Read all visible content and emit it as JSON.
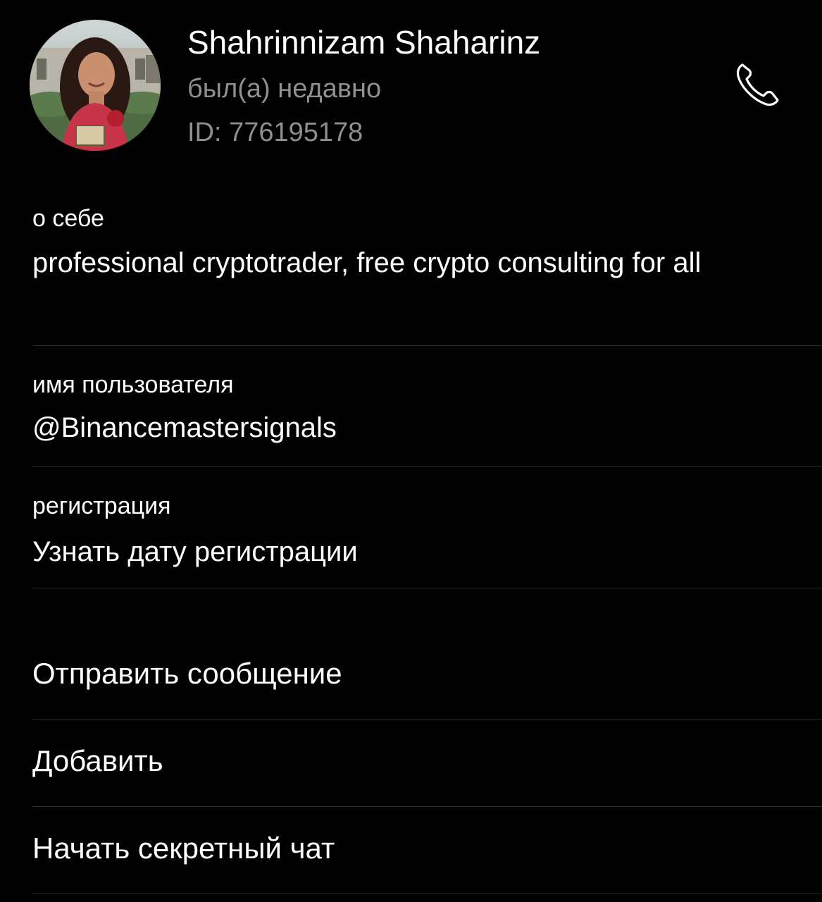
{
  "profile": {
    "name": "Shahrinnizam Shaharinz",
    "status": "был(а) недавно",
    "id_text": "ID: 776195178"
  },
  "about": {
    "label": "о себе",
    "value": "professional cryptotrader, free crypto consulting for all"
  },
  "username": {
    "label": "имя пользователя",
    "value": "@Binancemastersignals"
  },
  "registration": {
    "label": "регистрация",
    "value": "Узнать дату регистрации"
  },
  "actions": {
    "send_message": "Отправить сообщение",
    "add": "Добавить",
    "secret_chat": "Начать секретный чат"
  },
  "icons": {
    "call": "phone-icon"
  },
  "colors": {
    "background": "#000000",
    "text": "#ffffff",
    "secondary_text": "#8e8e93",
    "divider": "#2c2c2e"
  }
}
